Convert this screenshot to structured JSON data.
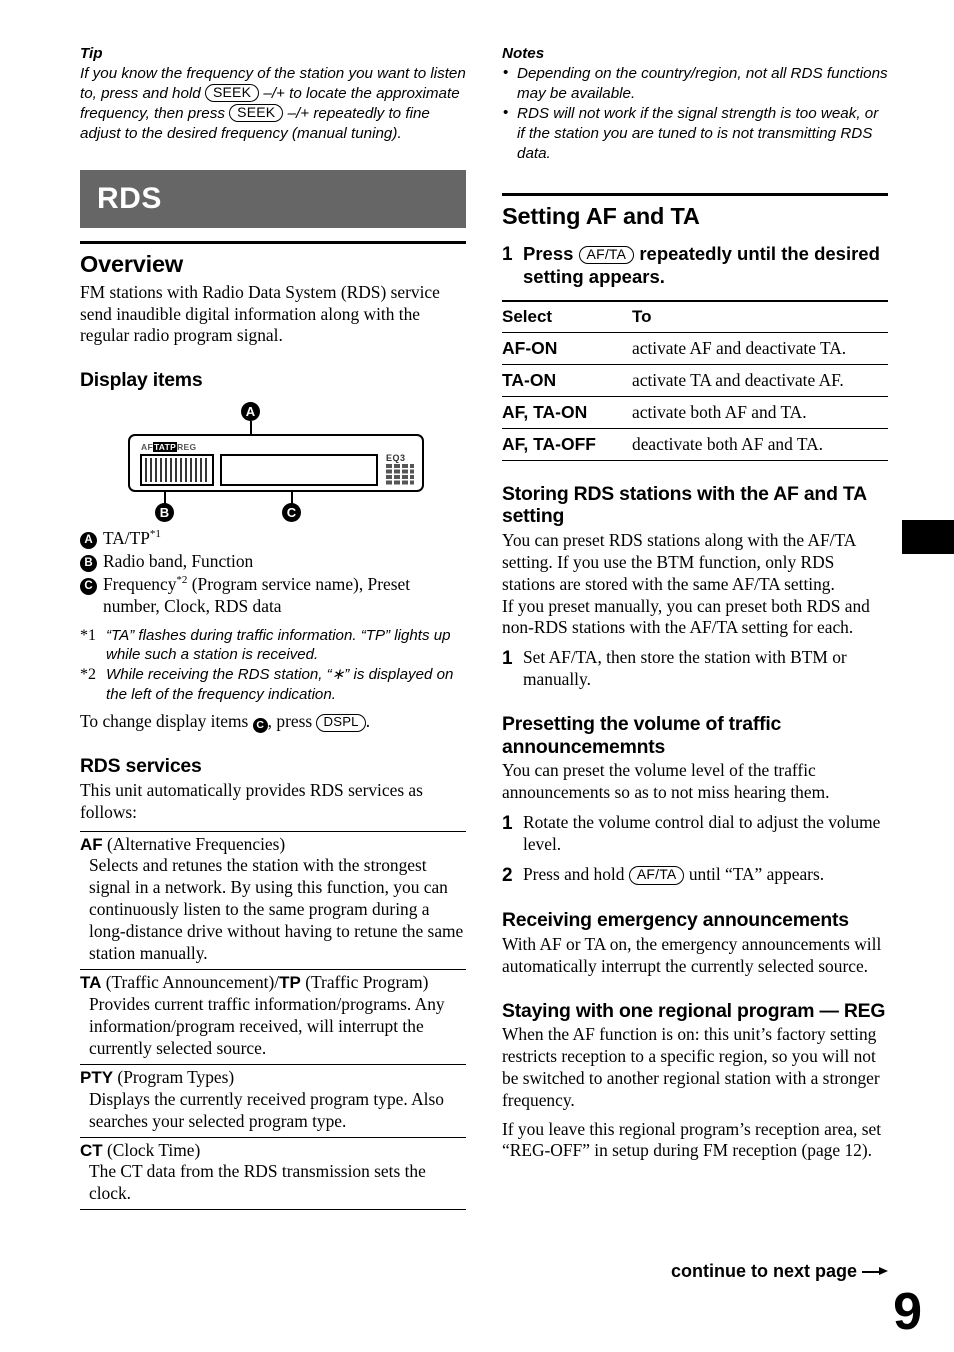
{
  "page": {
    "number": "9",
    "continue_label": "continue to next page",
    "continue_icon": "arrow-right-icon"
  },
  "left_column": {
    "tip": {
      "heading": "Tip",
      "text_before_btn1": "If you know the frequency of the station you want to listen to, press and hold",
      "button1": "SEEK",
      "text_mid": "–/+ to locate the approximate frequency, then press",
      "button2": "SEEK",
      "text_after": "–/+ repeatedly to fine adjust to the desired frequency (manual tuning)."
    },
    "section_banner": "RDS",
    "overview": {
      "heading": "Overview",
      "body": "FM stations with Radio Data System (RDS) service send inaudible digital information along with the regular radio program signal."
    },
    "display_items": {
      "heading": "Display items",
      "diagram": {
        "callout_a": "A",
        "callout_b": "B",
        "callout_c": "C",
        "indicators": [
          "AF",
          "TA",
          "TP",
          "REG"
        ],
        "highlighted_indicators": [
          "TA",
          "TP"
        ],
        "eq_label": "EQ3"
      },
      "legend": [
        {
          "mark": "A",
          "text": "TA/TP",
          "footnote": "1"
        },
        {
          "mark": "B",
          "text": "Radio band, Function",
          "footnote": ""
        },
        {
          "mark": "C",
          "text": "Frequency",
          "footnote": "2",
          "text_rest": " (Program service name), Preset number, Clock, RDS data"
        }
      ],
      "footnotes": [
        {
          "key": "*1",
          "text": "“TA” flashes during traffic information. “TP” lights up while such a station is received."
        },
        {
          "key": "*2",
          "text": "While receiving the RDS station, “∗” is displayed on the left of the frequency indication."
        }
      ],
      "change_items": {
        "before": "To change display items",
        "mark": "C",
        "middle": ", press",
        "button": "DSPL",
        "after": "."
      }
    },
    "rds_services": {
      "heading": "RDS services",
      "intro": "This unit automatically provides RDS services as follows:",
      "items": [
        {
          "abbr": "AF",
          "term_rest": " (Alternative Frequencies)",
          "definition": "Selects and retunes the station with the strongest signal in a network. By using this function, you can continuously listen to the same program during a long-distance drive without having to retune the same station manually."
        },
        {
          "abbr": "TA",
          "term_rest": " (Traffic Announcement)/",
          "abbr2": "TP",
          "term_rest2": " (Traffic Program)",
          "definition": "Provides current traffic information/programs. Any information/program received, will interrupt the currently selected source."
        },
        {
          "abbr": "PTY",
          "term_rest": " (Program Types)",
          "definition": "Displays the currently received program type. Also searches your selected program type."
        },
        {
          "abbr": "CT",
          "term_rest": " (Clock Time)",
          "definition": "The CT data from the RDS transmission sets the clock."
        }
      ]
    }
  },
  "right_column": {
    "notes": {
      "heading": "Notes",
      "items": [
        "Depending on the country/region, not all RDS functions may be available.",
        "RDS will not work if the signal strength is too weak, or if the station you are tuned to is not transmitting RDS data."
      ]
    },
    "setting_af_ta": {
      "heading": "Setting AF and TA",
      "step_num": "1",
      "step_before": "Press",
      "step_button": "AF/TA",
      "step_after": "repeatedly until the desired setting appears.",
      "table": {
        "headers": [
          "Select",
          "To"
        ],
        "rows": [
          [
            "AF-ON",
            "activate AF and deactivate TA."
          ],
          [
            "TA-ON",
            "activate TA and deactivate AF."
          ],
          [
            "AF, TA-ON",
            "activate both AF and TA."
          ],
          [
            "AF, TA-OFF",
            "deactivate both AF and TA."
          ]
        ]
      }
    },
    "storing_rds": {
      "heading": "Storing RDS stations with the AF and TA setting",
      "para1": "You can preset RDS stations along with the AF/TA setting. If you use the BTM function, only RDS stations are stored with the same AF/TA setting.",
      "para2": "If you preset manually, you can preset both RDS and non-RDS stations with the AF/TA setting for each.",
      "step_num": "1",
      "step_text": "Set AF/TA, then store the station with BTM or manually."
    },
    "presetting_volume": {
      "heading": "Presetting the volume of traffic announcememnts",
      "body": "You can preset the volume level of the traffic announcements so as to not miss hearing them.",
      "steps": [
        {
          "num": "1",
          "text": "Rotate the volume control dial to adjust the volume level."
        },
        {
          "num": "2",
          "before": "Press and hold",
          "button": "AF/TA",
          "after": "until “TA” appears."
        }
      ]
    },
    "emergency": {
      "heading": "Receiving emergency announcements",
      "body": "With AF or TA on, the emergency announcements will automatically interrupt the currently selected source."
    },
    "regional": {
      "heading": "Staying with one regional program — REG",
      "para1": "When the AF function is on: this unit’s factory setting restricts reception to a specific region, so you will not be switched to another regional station with a stronger frequency.",
      "para2": "If you leave this regional program’s reception area, set “REG-OFF” in setup during FM reception (page 12)."
    }
  },
  "colors": {
    "banner_bg": "#666666",
    "banner_text": "#ffffff",
    "text": "#000000",
    "page_bg": "#ffffff"
  }
}
